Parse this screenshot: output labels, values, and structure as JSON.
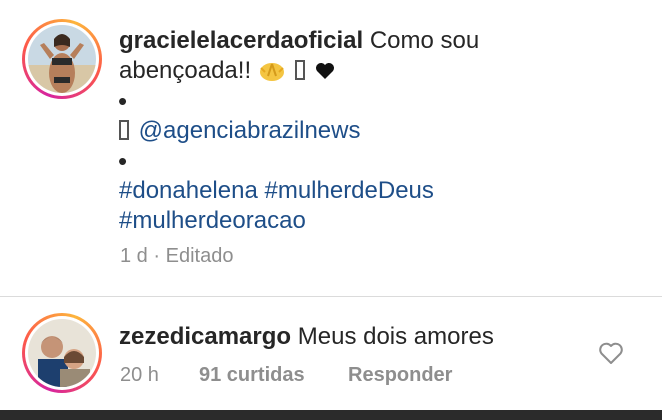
{
  "post": {
    "username": "gracielelacerdaoficial",
    "caption_line1": "Como sou",
    "caption_line2": "abençoada!!",
    "dot": "•",
    "mention": "@agenciabrazilnews",
    "hashtags_line1": "#donahelena #mulherdeDeus",
    "hashtags_line2": "#mulherdeoracao",
    "time": "1 d",
    "separator": "·",
    "edited": "Editado"
  },
  "comment": {
    "username": "zezedicamargo",
    "text": "Meus dois amores",
    "time": "20 h",
    "likes": "91 curtidas",
    "reply": "Responder"
  },
  "icons": {
    "pray": "folded-hands-emoji",
    "heart_black": "black-heart-emoji",
    "like": "heart-outline-icon"
  },
  "colors": {
    "hashtag": "#1e4e88",
    "meta": "#8e8e8e",
    "text": "#262626"
  }
}
